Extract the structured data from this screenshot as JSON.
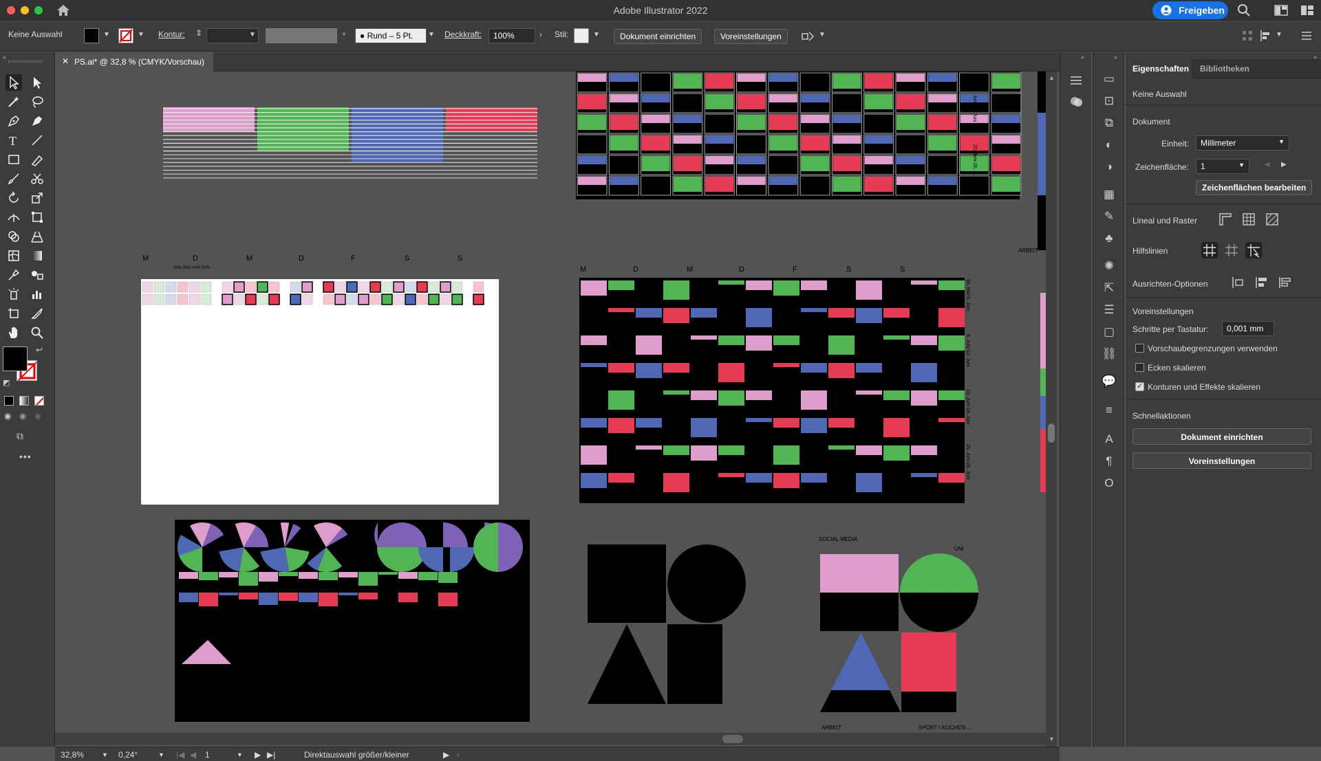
{
  "titlebar": {
    "title": "Adobe Illustrator 2022",
    "share_label": "Freigeben"
  },
  "control": {
    "selection": "Keine Auswahl",
    "stroke_label": "Kontur:",
    "brush_label": "Rund – 5 Pt.",
    "opacity_label": "Deckkraft:",
    "opacity_value": "100%",
    "style_label": "Stil:",
    "doc_setup": "Dokument einrichten",
    "preferences": "Voreinstellungen"
  },
  "document_tab": {
    "label": "PS.ai* @ 32,8 % (CMYK/Vorschau)"
  },
  "panel": {
    "tab_properties": "Eigenschaften",
    "tab_libraries": "Bibliotheken",
    "no_selection": "Keine Auswahl",
    "document_heading": "Dokument",
    "unit_label": "Einheit:",
    "unit_value": "Millimeter",
    "artboard_label": "Zeichenfläche:",
    "artboard_value": "1",
    "edit_artboards": "Zeichenflächen bearbeiten",
    "rulers_grid": "Lineal und Raster",
    "guides": "Hilfslinien",
    "align_options": "Ausrichten-Optionen",
    "preferences_heading": "Voreinstellungen",
    "keyboard_increment_label": "Schritte per Tastatur:",
    "keyboard_increment_value": "0,001 mm",
    "use_preview_bounds": "Vorschaubegrenzungen verwenden",
    "scale_corners": "Ecken skalieren",
    "scale_strokes_effects": "Konturen und Effekte skalieren",
    "quick_actions": "Schnellaktionen",
    "qa_doc_setup": "Dokument einrichten",
    "qa_preferences": "Voreinstellungen"
  },
  "status": {
    "zoom": "32,8%",
    "angle": "0,24°",
    "artboard": "1",
    "tool_hint": "Direktauswahl größer/kleiner"
  },
  "artwork": {
    "days": [
      "M",
      "D",
      "M",
      "D",
      "F",
      "S",
      "S"
    ],
    "pct_labels": "30%  25%  40%  50%",
    "week_labels": [
      "30. Mai-5. Juni",
      "6. Juni-12. Juni",
      "13. Juni-19. Juni",
      "20. Juni-26. Juni"
    ],
    "week_labels_top": [
      "13. Juni-19. Juni",
      "20. Juni-26. Juni"
    ],
    "arbeit_top": "ARBEIT",
    "social_media": "SOCIAL MEDIA",
    "uni": "UNI",
    "arbeit": "ARBEIT",
    "sport": "SPORT / KOCHEN ..."
  },
  "colors": {
    "pink": "#df9dcb",
    "green": "#52b554",
    "blue": "#4e68b6",
    "red": "#e63b55",
    "purple": "#7d62b6"
  }
}
